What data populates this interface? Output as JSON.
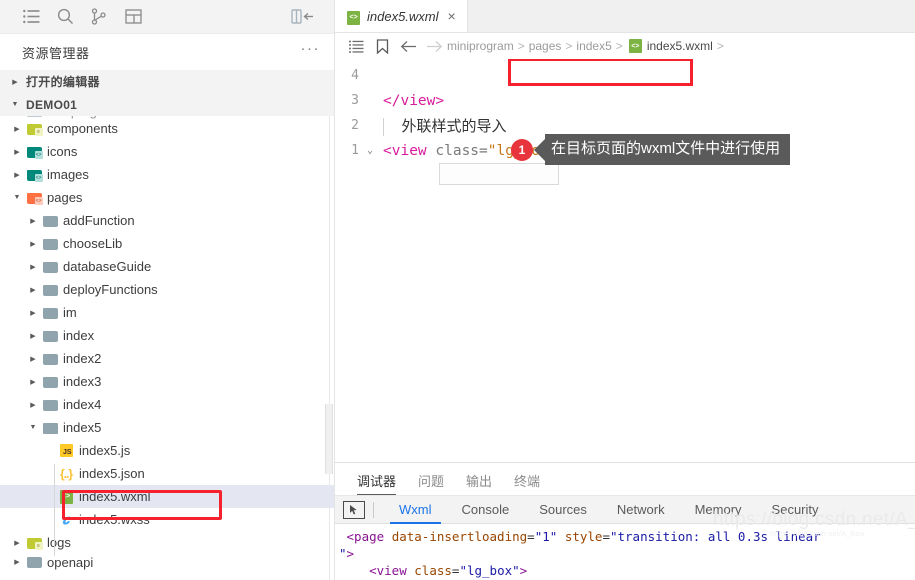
{
  "sidebar": {
    "activity_icons": [
      {
        "name": "explorer-icon",
        "glyph": "list"
      },
      {
        "name": "search-icon",
        "glyph": "search"
      },
      {
        "name": "source-control-icon",
        "glyph": "branch"
      },
      {
        "name": "extensions-icon",
        "glyph": "layout"
      }
    ],
    "collapse_icon": "collapse-sidebar-icon",
    "explorer_title": "资源管理器",
    "more_actions": "···",
    "sections": [
      {
        "label": "打开的编辑器",
        "expanded": false
      },
      {
        "label": "DEMO01",
        "expanded": true
      }
    ],
    "tree": [
      {
        "label": "miniprogram",
        "indent": 1,
        "type": "folder-grey-open",
        "twist": "open",
        "cut": true
      },
      {
        "label": "components",
        "indent": 1,
        "type": "folder-lime",
        "twist": "closed"
      },
      {
        "label": "icons",
        "indent": 1,
        "type": "folder-teal",
        "twist": "closed"
      },
      {
        "label": "images",
        "indent": 1,
        "type": "folder-teal",
        "twist": "closed"
      },
      {
        "label": "pages",
        "indent": 1,
        "type": "folder-orange",
        "twist": "open"
      },
      {
        "label": "addFunction",
        "indent": 2,
        "type": "folder-grey",
        "twist": "closed"
      },
      {
        "label": "chooseLib",
        "indent": 2,
        "type": "folder-grey",
        "twist": "closed"
      },
      {
        "label": "databaseGuide",
        "indent": 2,
        "type": "folder-grey",
        "twist": "closed"
      },
      {
        "label": "deployFunctions",
        "indent": 2,
        "type": "folder-grey",
        "twist": "closed"
      },
      {
        "label": "im",
        "indent": 2,
        "type": "folder-grey",
        "twist": "closed"
      },
      {
        "label": "index",
        "indent": 2,
        "type": "folder-grey",
        "twist": "closed"
      },
      {
        "label": "index2",
        "indent": 2,
        "type": "folder-grey",
        "twist": "closed"
      },
      {
        "label": "index3",
        "indent": 2,
        "type": "folder-grey",
        "twist": "closed"
      },
      {
        "label": "index4",
        "indent": 2,
        "type": "folder-grey",
        "twist": "closed"
      },
      {
        "label": "index5",
        "indent": 2,
        "type": "folder-grey-open",
        "twist": "open"
      },
      {
        "label": "index5.js",
        "indent": 3,
        "type": "file-js",
        "twist": "blank"
      },
      {
        "label": "index5.json",
        "indent": 3,
        "type": "file-json",
        "twist": "blank"
      },
      {
        "label": "index5.wxml",
        "indent": 3,
        "type": "file-wxml",
        "twist": "blank",
        "selected": true,
        "highlighted": true
      },
      {
        "label": "index5.wxss",
        "indent": 3,
        "type": "file-wxss",
        "twist": "blank"
      },
      {
        "label": "logs",
        "indent": 1,
        "type": "folder-lime",
        "twist": "closed"
      },
      {
        "label": "openapi",
        "indent": 1,
        "type": "folder-grey",
        "twist": "closed",
        "cut": true
      }
    ]
  },
  "editor": {
    "tab": {
      "label": "index5.wxml",
      "icon": "wxml-file-icon",
      "close": "×"
    },
    "toolbar_icons": [
      {
        "name": "outline-icon"
      },
      {
        "name": "bookmark-icon"
      },
      {
        "name": "back-arrow-icon"
      },
      {
        "name": "forward-arrow-icon"
      }
    ],
    "breadcrumb": [
      "miniprogram",
      "pages",
      "index5",
      "index5.wxml"
    ],
    "breadcrumb_separator": ">",
    "breadcrumb_trailing": ">",
    "lines": [
      {
        "num": "1",
        "fold": "⌄",
        "tokens": [
          {
            "t": "tag",
            "v": "<view"
          },
          {
            "t": "plain",
            "v": " "
          },
          {
            "t": "attr",
            "v": "class"
          },
          {
            "t": "eq",
            "v": "="
          },
          {
            "t": "str",
            "v": "\"lg_box\""
          },
          {
            "t": "tag",
            "v": ">"
          }
        ]
      },
      {
        "num": "2",
        "fold": "",
        "tokens": [
          {
            "t": "indent",
            "v": ""
          },
          {
            "t": "cn",
            "v": "外联样式的导入"
          }
        ]
      },
      {
        "num": "3",
        "fold": "",
        "tokens": [
          {
            "t": "tag",
            "v": "</view>"
          }
        ]
      },
      {
        "num": "4",
        "fold": "",
        "tokens": []
      }
    ],
    "callout": {
      "badge": "1",
      "text": "在目标页面的wxml文件中进行使用"
    }
  },
  "panel": {
    "tabs": [
      {
        "label": "调试器",
        "active": true
      },
      {
        "label": "问题",
        "active": false
      },
      {
        "label": "输出",
        "active": false
      },
      {
        "label": "终端",
        "active": false
      }
    ],
    "devtools": {
      "inspect_icon": "inspect-element-icon",
      "tabs": [
        {
          "label": "Wxml",
          "active": true
        },
        {
          "label": "Console",
          "active": false
        },
        {
          "label": "Sources",
          "active": false
        },
        {
          "label": "Network",
          "active": false
        },
        {
          "label": "Memory",
          "active": false
        },
        {
          "label": "Security",
          "active": false
        }
      ],
      "code_lines": [
        [
          {
            "t": "plain",
            "v": " "
          },
          {
            "t": "tag",
            "v": "<page"
          },
          {
            "t": "plain",
            "v": " "
          },
          {
            "t": "attr",
            "v": "data-insertloading"
          },
          {
            "t": "plain",
            "v": "="
          },
          {
            "t": "val",
            "v": "\"1\""
          },
          {
            "t": "plain",
            "v": " "
          },
          {
            "t": "attr",
            "v": "style"
          },
          {
            "t": "plain",
            "v": "="
          },
          {
            "t": "val",
            "v": "\"transition: all 0.3s linear"
          }
        ],
        [
          {
            "t": "val",
            "v": "\""
          },
          {
            "t": "tag",
            "v": ">"
          }
        ],
        [
          {
            "t": "plain",
            "v": "    "
          },
          {
            "t": "tag",
            "v": "<view"
          },
          {
            "t": "plain",
            "v": " "
          },
          {
            "t": "attr",
            "v": "class"
          },
          {
            "t": "plain",
            "v": "="
          },
          {
            "t": "val",
            "v": "\"lg_box\""
          },
          {
            "t": "tag",
            "v": ">"
          }
        ]
      ]
    }
  },
  "watermark": {
    "main": "https://blog.csdn.net/A_Bow",
    "small": "https://blog.csdn.net/A_Bow"
  },
  "colors": {
    "accent_blue": "#1a73e8",
    "highlight_red": "#f5222d",
    "badge_red": "#e8343c",
    "callout_grey": "#5a5a5a",
    "selection": "#e4e6f1"
  }
}
